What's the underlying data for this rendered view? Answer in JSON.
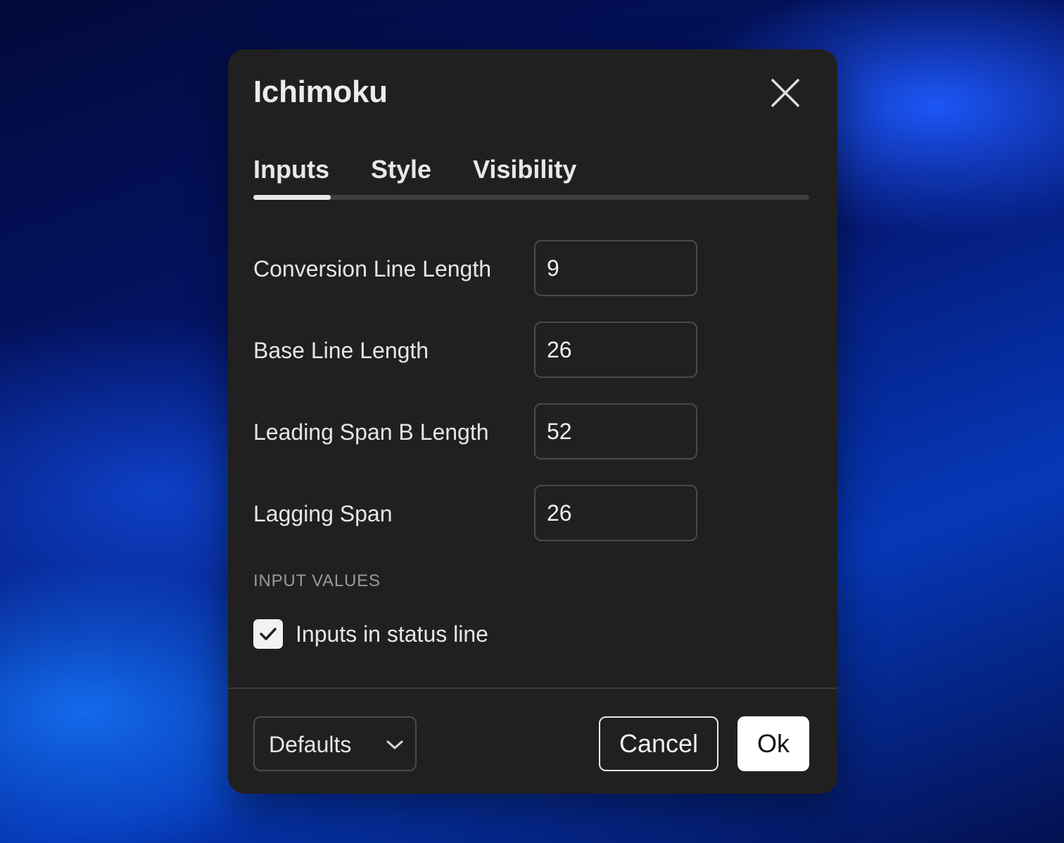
{
  "dialog": {
    "title": "Ichimoku",
    "close_icon": "close-icon"
  },
  "tabs": [
    {
      "label": "Inputs",
      "active": true
    },
    {
      "label": "Style",
      "active": false
    },
    {
      "label": "Visibility",
      "active": false
    }
  ],
  "inputs": [
    {
      "label": "Conversion Line Length",
      "value": "9"
    },
    {
      "label": "Base Line Length",
      "value": "26"
    },
    {
      "label": "Leading Span B Length",
      "value": "52"
    },
    {
      "label": "Lagging Span",
      "value": "26"
    }
  ],
  "input_values": {
    "section_title": "INPUT VALUES",
    "checkbox_label": "Inputs in status line",
    "checked": true,
    "check_icon": "checkmark-icon"
  },
  "footer": {
    "defaults_label": "Defaults",
    "defaults_icon": "chevron-down-icon",
    "cancel_label": "Cancel",
    "ok_label": "Ok"
  },
  "colors": {
    "dialog_background": "#202020",
    "accent": "#ffffff",
    "muted_text": "#9a9a9a"
  }
}
